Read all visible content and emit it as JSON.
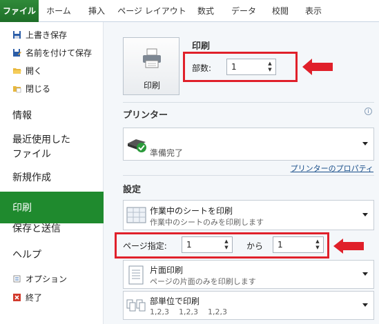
{
  "tabs": [
    "ファイル",
    "ホーム",
    "挿入",
    "ページ レイアウト",
    "数式",
    "データ",
    "校閲",
    "表示"
  ],
  "nav": {
    "small_top": [
      "上書き保存",
      "名前を付けて保存",
      "開く",
      "閉じる"
    ],
    "big": [
      "情報",
      "最近使用した",
      "ファイル",
      "新規作成",
      "印刷",
      "保存と送信",
      "ヘルプ"
    ],
    "small_bottom": [
      "オプション",
      "終了"
    ]
  },
  "print": {
    "button_label": "印刷",
    "heading": "印刷",
    "copies_label": "部数:",
    "copies_value": "1"
  },
  "printer": {
    "heading": "プリンター",
    "status": "準備完了",
    "properties_link": "プリンターのプロパティ"
  },
  "settings": {
    "heading": "設定",
    "scope_title": "作業中のシートを印刷",
    "scope_sub": "作業中のシートのみを印刷します",
    "pages_label": "ページ指定:",
    "from_value": "1",
    "to_label": "から",
    "to_value": "1",
    "sides_title": "片面印刷",
    "sides_sub": "ページの片面のみを印刷します",
    "collate_title": "部単位で印刷",
    "collate_sub": "1,2,3    1,2,3    1,2,3"
  },
  "colors": {
    "accent": "#1f8a2e",
    "highlight": "#e0202a"
  }
}
